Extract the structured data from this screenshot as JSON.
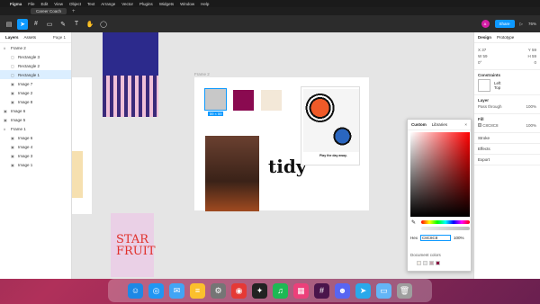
{
  "menubar": {
    "app": "Figma",
    "items": [
      "File",
      "Edit",
      "View",
      "Object",
      "Text",
      "Arrange",
      "Vector",
      "Plugins",
      "Widgets",
      "Window",
      "Help"
    ],
    "right": [
      "",
      "76%"
    ]
  },
  "toolbar": {
    "tab_title": "Career Coach",
    "avatar": "A",
    "share": "Share",
    "zoom": "76%"
  },
  "left_panel": {
    "tabs": [
      "Layers",
      "Assets"
    ],
    "page": "Page 1",
    "layers": [
      {
        "label": "Frame 2",
        "child": false,
        "icon": "#"
      },
      {
        "label": "Rectangle 3",
        "child": true,
        "icon": "▢"
      },
      {
        "label": "Rectangle 2",
        "child": true,
        "icon": "▢"
      },
      {
        "label": "Rectangle 1",
        "child": true,
        "icon": "▢",
        "selected": true
      },
      {
        "label": "Image 7",
        "child": true,
        "icon": "▣"
      },
      {
        "label": "Image 2",
        "child": true,
        "icon": "▣"
      },
      {
        "label": "Image 8",
        "child": true,
        "icon": "▣"
      },
      {
        "label": "Image 6",
        "child": false,
        "icon": "▣"
      },
      {
        "label": "Image 5",
        "child": false,
        "icon": "▣"
      },
      {
        "label": "Frame 1",
        "child": false,
        "icon": "#"
      },
      {
        "label": "Image 6",
        "child": true,
        "icon": "▣"
      },
      {
        "label": "Image 4",
        "child": true,
        "icon": "▣"
      },
      {
        "label": "Image 3",
        "child": true,
        "icon": "▣"
      },
      {
        "label": "Image 1",
        "child": true,
        "icon": "▣"
      }
    ]
  },
  "canvas": {
    "frame_label": "Frame 2",
    "size_badge": "59 × 59",
    "poster_text": "Play the day away.",
    "tidy_text": "tidy",
    "starfruit": "STAR FRUIT"
  },
  "right_panel": {
    "tabs": [
      "Design",
      "Prototype"
    ],
    "x_label": "X",
    "x_val": "37",
    "y_label": "Y",
    "y_val": "59",
    "w_label": "W",
    "w_val": "59",
    "h_label": "H",
    "h_val": "59",
    "rot_label": "0°",
    "rad_label": "0",
    "constraints_title": "Constraints",
    "constraint_h": "Left",
    "constraint_v": "Top",
    "layer_title": "Layer",
    "pass_through": "Pass through",
    "opacity": "100%",
    "fill_title": "Fill",
    "fill_hex": "C8C8C8",
    "fill_opacity": "100%",
    "stroke_title": "Stroke",
    "effects_title": "Effects",
    "export_title": "Export"
  },
  "color_popup": {
    "tabs": [
      "Custom",
      "Libraries"
    ],
    "hex_label": "Hex",
    "hex_value": "C8C8C8",
    "opacity": "100%",
    "doc_colors_label": "Document colors",
    "swatches": [
      "#f5f0e8",
      "#e8e8e8",
      "#c8a8b0",
      "#8a0040"
    ]
  },
  "dock": {
    "apps": [
      {
        "name": "finder-icon",
        "color": "#1e88e5",
        "glyph": "☺"
      },
      {
        "name": "safari-icon",
        "color": "#2196f3",
        "glyph": "◎"
      },
      {
        "name": "mail-icon",
        "color": "#42a5f5",
        "glyph": "✉"
      },
      {
        "name": "notes-icon",
        "color": "#fbc02d",
        "glyph": "≡"
      },
      {
        "name": "settings-icon",
        "color": "#757575",
        "glyph": "⚙"
      },
      {
        "name": "chrome-icon",
        "color": "#e53935",
        "glyph": "◉"
      },
      {
        "name": "figma-icon",
        "color": "#222",
        "glyph": "✦"
      },
      {
        "name": "spotify-icon",
        "color": "#1db954",
        "glyph": "♫"
      },
      {
        "name": "mirror-icon",
        "color": "#ec407a",
        "glyph": "▦"
      },
      {
        "name": "slack-icon",
        "color": "#4a154b",
        "glyph": "#"
      },
      {
        "name": "discord-icon",
        "color": "#5865f2",
        "glyph": "☻"
      },
      {
        "name": "telegram-icon",
        "color": "#29a9ea",
        "glyph": "➤"
      },
      {
        "name": "folder-icon",
        "color": "#64b5f6",
        "glyph": "▭"
      },
      {
        "name": "trash-icon",
        "color": "#9e9e9e",
        "glyph": "🗑"
      }
    ]
  }
}
